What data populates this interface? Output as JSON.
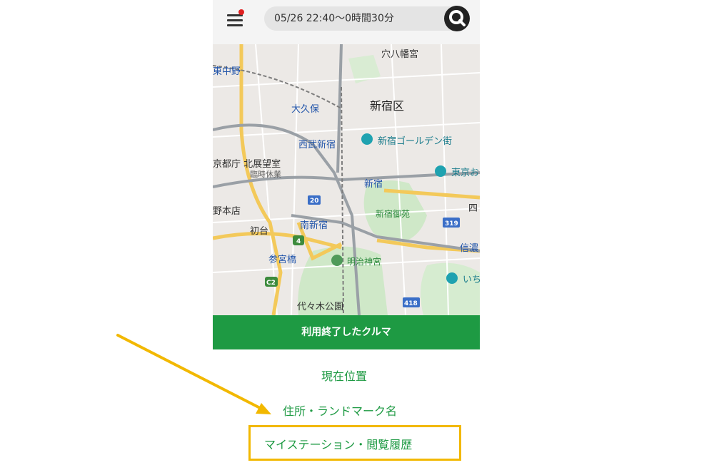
{
  "header": {
    "search_text": "05/26 22:40〜0時間30分",
    "search_icon": "search-icon",
    "menu_icon": "hamburger-menu-icon"
  },
  "map": {
    "labels": {
      "rokuhachiman": "穴八幡宮",
      "higashinakano": "東中野",
      "okubo": "大久保",
      "shinjuku_ku": "新宿区",
      "seibu_shinjuku": "西武新宿",
      "golden_gai": "新宿ゴールデン街",
      "tocho": "京都庁 北展望室",
      "tocho_closed": "臨時休業",
      "tokyo": "東京お",
      "shinjuku": "新宿",
      "nakano_honten": "野本店",
      "gyoen": "新宿御苑",
      "yotsu": "四",
      "minami_shinjuku": "南新宿",
      "hatsudai": "初台",
      "shinano": "信濃",
      "sangubashi": "参宮橋",
      "meiji_jingu": "明治神宮",
      "ichi": "いち",
      "yoyogi_koen": "代々木公園"
    },
    "shields": {
      "r20": "20",
      "r4": "4",
      "r319": "319",
      "c2": "C2",
      "r418": "418"
    }
  },
  "actions": {
    "used_cars_button": "利用終了したクルマ",
    "menu_items": [
      "現在位置",
      "住所・ランドマーク名",
      "マイステーション・閲覧履歴"
    ]
  },
  "colors": {
    "brand_green": "#1e9a43",
    "highlight_yellow": "#f2b800",
    "notification_red": "#e02020"
  }
}
